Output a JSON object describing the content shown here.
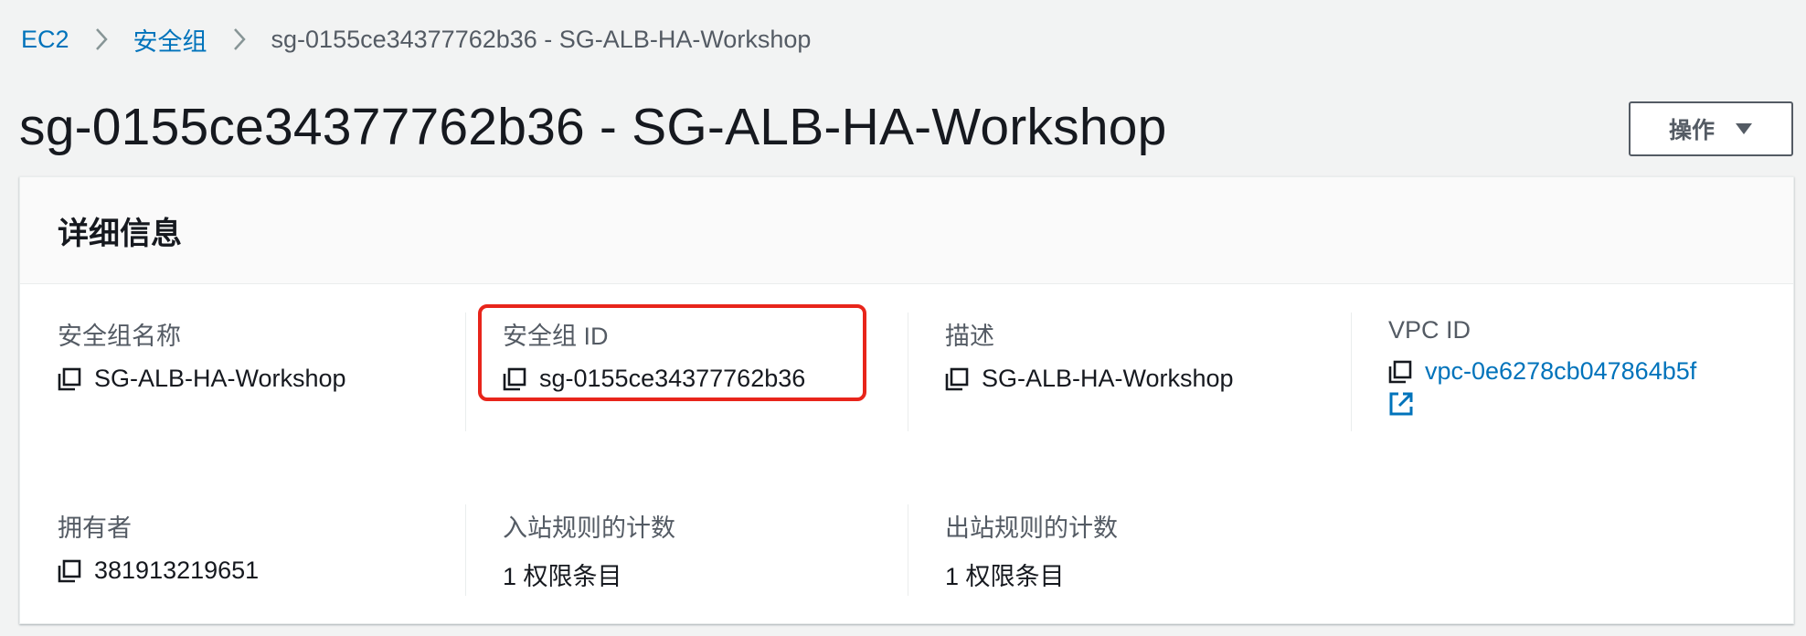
{
  "breadcrumb": {
    "items": [
      "EC2",
      "安全组"
    ],
    "current": "sg-0155ce34377762b36 - SG-ALB-HA-Workshop"
  },
  "page": {
    "title": "sg-0155ce34377762b36 - SG-ALB-HA-Workshop",
    "actions_label": "操作"
  },
  "details": {
    "title": "详细信息",
    "sg_name_label": "安全组名称",
    "sg_name_value": "SG-ALB-HA-Workshop",
    "sg_id_label": "安全组 ID",
    "sg_id_value": "sg-0155ce34377762b36",
    "description_label": "描述",
    "description_value": "SG-ALB-HA-Workshop",
    "vpc_id_label": "VPC ID",
    "vpc_id_value": "vpc-0e6278cb047864b5f",
    "owner_label": "拥有者",
    "owner_value": "381913219651",
    "inbound_label": "入站规则的计数",
    "inbound_value": "1 权限条目",
    "outbound_label": "出站规则的计数",
    "outbound_value": "1 权限条目"
  },
  "colors": {
    "link": "#0073bb",
    "highlight": "#e8251b"
  },
  "icons": [
    "chevron-right-icon",
    "caret-down-icon",
    "copy-icon",
    "external-link-icon"
  ]
}
